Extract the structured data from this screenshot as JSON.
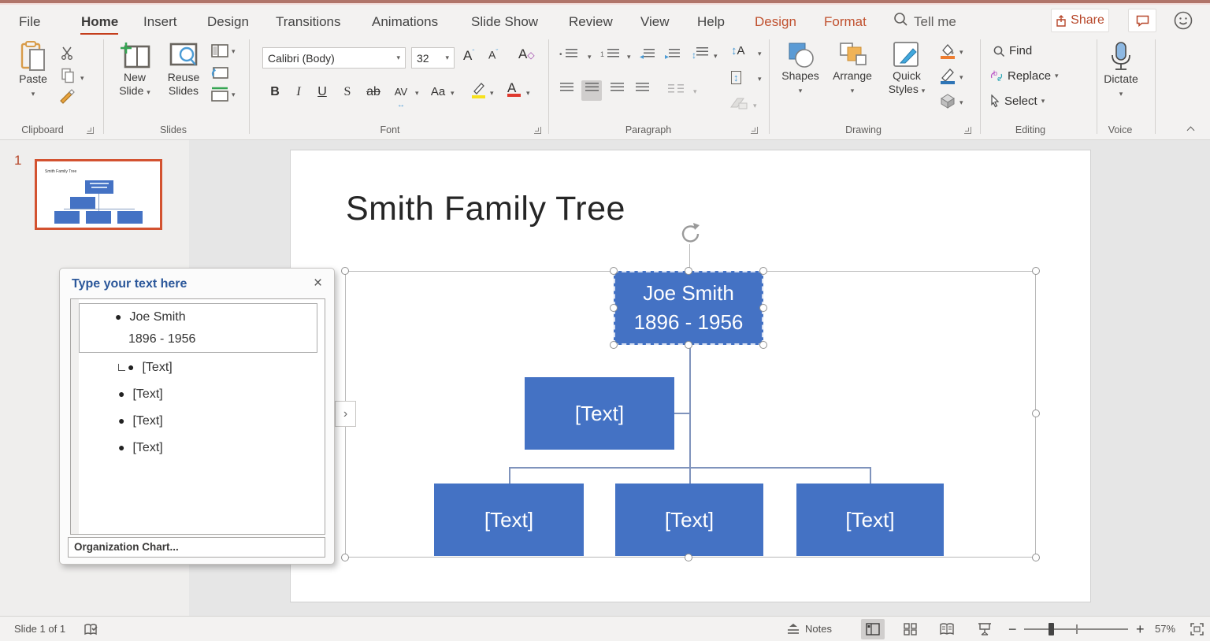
{
  "menu": {
    "tabs": [
      "File",
      "Home",
      "Insert",
      "Design",
      "Transitions",
      "Animations",
      "Slide Show",
      "Review",
      "View",
      "Help"
    ],
    "context_tabs": [
      "Design",
      "Format"
    ],
    "tell_me": "Tell me",
    "share": "Share"
  },
  "ribbon": {
    "clipboard": {
      "title": "Clipboard",
      "paste": "Paste"
    },
    "slides": {
      "title": "Slides",
      "new_line1": "New",
      "new_line2": "Slide",
      "reuse_line1": "Reuse",
      "reuse_line2": "Slides"
    },
    "font": {
      "title": "Font",
      "family": "Calibri (Body)",
      "size": "32",
      "bold": "B",
      "italic": "I",
      "underline": "U",
      "strike": "S",
      "ab": "ab",
      "av": "AV",
      "aa": "Aa"
    },
    "paragraph": {
      "title": "Paragraph"
    },
    "drawing": {
      "title": "Drawing",
      "shapes": "Shapes",
      "arrange": "Arrange",
      "quick_line1": "Quick",
      "quick_line2": "Styles"
    },
    "editing": {
      "title": "Editing",
      "find": "Find",
      "replace": "Replace",
      "select": "Select"
    },
    "voice": {
      "title": "Voice",
      "dictate": "Dictate"
    }
  },
  "thumbnails": {
    "number": "1",
    "mini_title": "Smith Family Tree"
  },
  "text_pane": {
    "title": "Type your text here",
    "item1_line1": "Joe Smith",
    "item1_line2": "1896 - 1956",
    "items": [
      "[Text]",
      "[Text]",
      "[Text]",
      "[Text]"
    ],
    "footer": "Organization Chart..."
  },
  "slide": {
    "title": "Smith Family Tree",
    "root_line1": "Joe Smith",
    "root_line2": "1896 - 1956",
    "assistant": "[Text]",
    "children": [
      "[Text]",
      "[Text]",
      "[Text]"
    ]
  },
  "status": {
    "slide_info": "Slide 1 of 1",
    "notes": "Notes",
    "zoom_level": "57%"
  },
  "colors": {
    "accent_blue": "#4472C4",
    "ppt_red": "#C43E1C",
    "context_tab": "#C0512F",
    "connector": "#7F93BC",
    "selected_thumb_border": "#D35230"
  }
}
